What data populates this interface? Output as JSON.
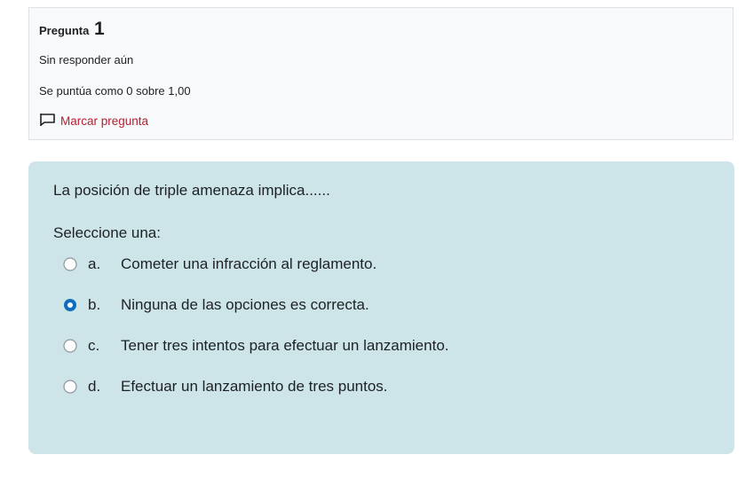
{
  "info": {
    "heading_label": "Pregunta",
    "question_number": "1",
    "state": "Sin responder aún",
    "grade": "Se puntúa como 0 sobre 1,00",
    "flag_label": "Marcar pregunta"
  },
  "question": {
    "text": "La posición de triple amenaza implica......",
    "prompt": "Seleccione una:",
    "answers": [
      {
        "letter": "a.",
        "text": "Cometer una infracción al reglamento.",
        "selected": false
      },
      {
        "letter": "b.",
        "text": "Ninguna de las opciones es correcta.",
        "selected": true
      },
      {
        "letter": "c.",
        "text": "Tener tres intentos para efectuar un lanzamiento.",
        "selected": false
      },
      {
        "letter": "d.",
        "text": "Efectuar un lanzamiento de tres puntos.",
        "selected": false
      }
    ]
  },
  "colors": {
    "info_background": "#f8f9fa",
    "content_background": "#cde5e8",
    "flag_link": "#b52133",
    "radio_selected": "#0f6cbf"
  }
}
